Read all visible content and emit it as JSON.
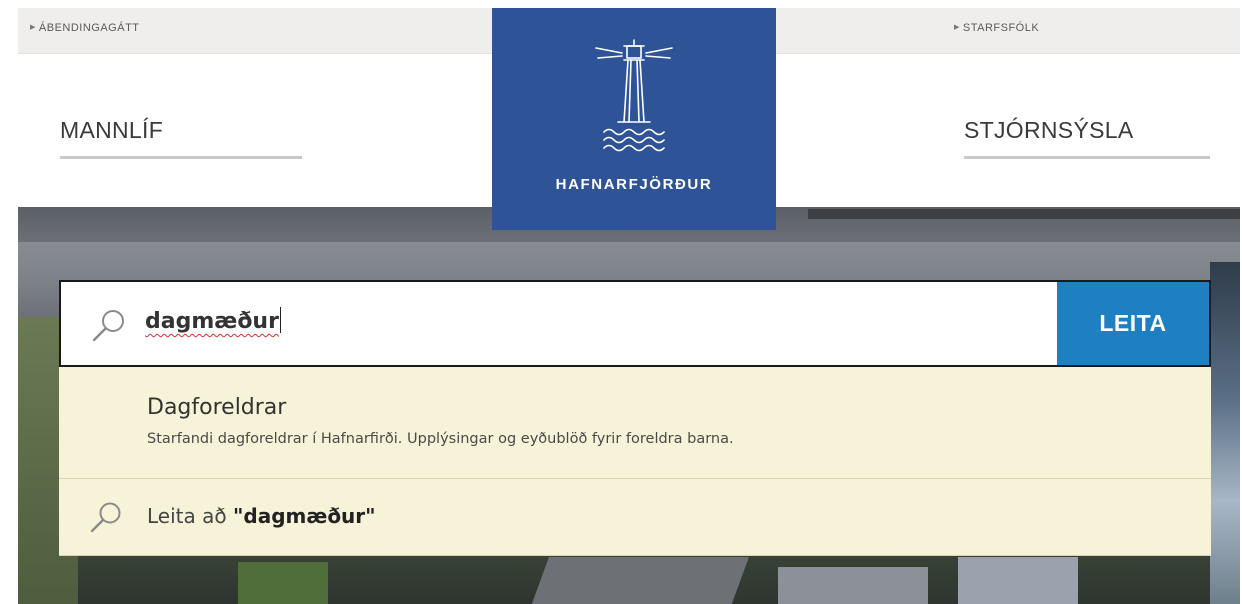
{
  "topbar": {
    "left_link": "ÁBENDINGAGÁTT",
    "right_link": "STARFSFÓLK"
  },
  "nav": {
    "left": "MANNLÍF",
    "right": "STJÓRNSÝSLA"
  },
  "logo": {
    "text": "HAFNARFJÖRÐUR",
    "icon": "lighthouse-icon",
    "color": "#2e5397"
  },
  "search": {
    "value": "dagmæður",
    "button_label": "LEITA",
    "button_color": "#1e7fc1",
    "icon": "search-icon"
  },
  "dropdown": {
    "background": "#f7f3d8",
    "suggestion": {
      "title": "Dagforeldrar",
      "description": "Starfandi dagforeldrar í Hafnarfirði. Upplýsingar og eyðublöð fyrir foreldra barna."
    },
    "search_for": {
      "prefix": "Leita að ",
      "query": "\"dagmæður\""
    }
  }
}
